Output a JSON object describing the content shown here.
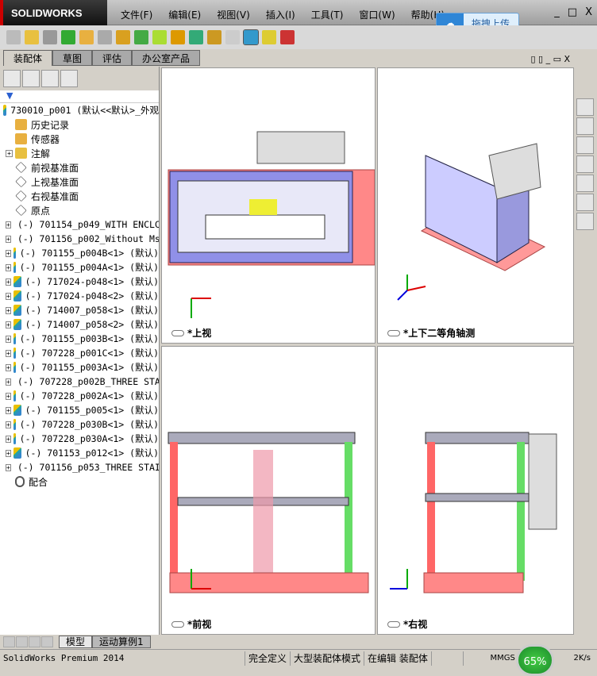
{
  "app": {
    "logo": "SOLIDWORKS"
  },
  "menu": [
    "文件(F)",
    "编辑(E)",
    "视图(V)",
    "插入(I)",
    "工具(T)",
    "窗口(W)",
    "帮助(H)"
  ],
  "upload_button": "拖拽上传",
  "command_tabs": [
    "装配体",
    "草图",
    "评估",
    "办公室产品"
  ],
  "tree": {
    "root": "730010_p001  (默认<<默认>_外观",
    "folders": [
      "历史记录",
      "传感器",
      "注解",
      "前视基准面",
      "上视基准面",
      "右视基准面",
      "原点"
    ],
    "components": [
      "(-) 701154_p049_WITH ENCLC",
      "(-) 701156_p002_Without Ms",
      "(-) 701155_p004B<1> (默认)",
      "(-) 701155_p004A<1> (默认)",
      "(-) 717024-p048<1> (默认)",
      "(-) 717024-p048<2> (默认)",
      "(-) 714007_p058<1> (默认)",
      "(-) 714007_p058<2> (默认)",
      "(-) 701155_p003B<1> (默认)",
      "(-) 707228_p001C<1> (默认)",
      "(-) 701155_p003A<1> (默认)",
      "(-) 707228_p002B_THREE STA",
      "(-) 707228_p002A<1> (默认)",
      "(-) 701155_p005<1> (默认)",
      "(-) 707228_p030B<1> (默认)",
      "(-) 707228_p030A<1> (默认)",
      "(-) 701153_p012<1> (默认)",
      "(-) 701156_p053_THREE STAI"
    ],
    "mates": "配合"
  },
  "viewports": {
    "top": "*上视",
    "iso": "*上下二等角轴测",
    "front": "*前视",
    "right": "*右视"
  },
  "bottom_tabs": [
    "模型",
    "运动算例1"
  ],
  "status": {
    "product": "SolidWorks Premium 2014",
    "cells": [
      "完全定义",
      "大型装配体模式",
      "在编辑 装配体"
    ],
    "units": "MMGS",
    "gauge": "65%",
    "speed": "2K/s"
  }
}
